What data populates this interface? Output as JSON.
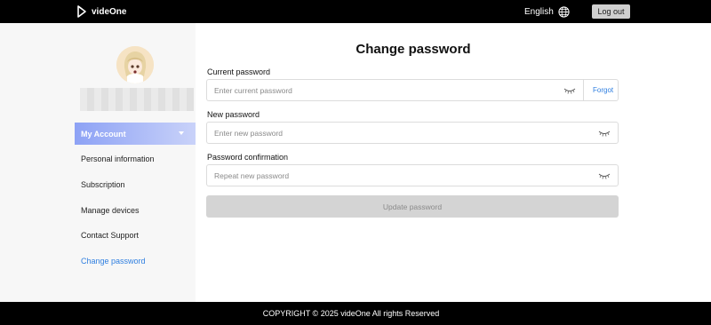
{
  "header": {
    "brand": "videOne",
    "language": "English",
    "logout_label": "Log out"
  },
  "sidebar": {
    "menu_title": "My Account",
    "items": [
      {
        "label": "Personal information",
        "active": false
      },
      {
        "label": "Subscription",
        "active": false
      },
      {
        "label": "Manage devices",
        "active": false
      },
      {
        "label": "Contact Support",
        "active": false
      },
      {
        "label": "Change password",
        "active": true
      }
    ]
  },
  "form": {
    "title": "Change password",
    "current": {
      "label": "Current password",
      "placeholder": "Enter current password",
      "value": ""
    },
    "forgot_label": "Forgot",
    "new": {
      "label": "New password",
      "placeholder": "Enter new password",
      "value": ""
    },
    "confirm": {
      "label": "Password confirmation",
      "placeholder": "Repeat new password",
      "value": ""
    },
    "submit_label": "Update password"
  },
  "footer": {
    "copyright": "COPYRIGHT © 2025 videOne All rights Reserved"
  },
  "colors": {
    "accent": "#2f7fe0",
    "menu_gradient_start": "#8da2f5",
    "menu_gradient_end": "#c9d2f9",
    "bar_background": "#000000",
    "disabled_button": "#d4d4d4"
  },
  "icons": [
    "videone-logo-icon",
    "globe-icon",
    "chevron-down-icon",
    "eye-closed-icon"
  ]
}
